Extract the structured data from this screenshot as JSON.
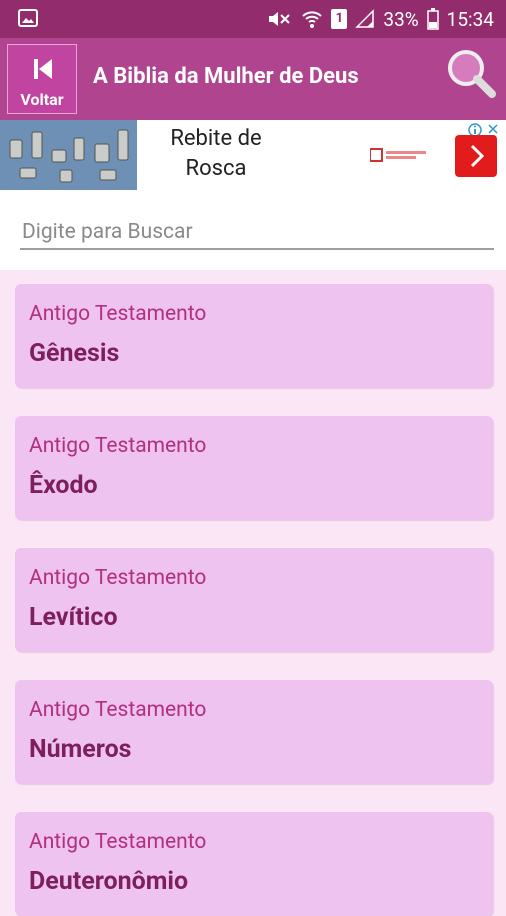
{
  "statusbar": {
    "battery": "33%",
    "time": "15:34",
    "sim": "1"
  },
  "appbar": {
    "back_label": "Voltar",
    "title": "A Biblia da Mulher de Deus"
  },
  "ad": {
    "text_line1": "Rebite de",
    "text_line2": "Rosca"
  },
  "search": {
    "placeholder": "Digite para Buscar"
  },
  "books": [
    {
      "testament": "Antigo Testamento",
      "name": "Gênesis"
    },
    {
      "testament": "Antigo Testamento",
      "name": "Êxodo"
    },
    {
      "testament": "Antigo Testamento",
      "name": "Levítico"
    },
    {
      "testament": "Antigo Testamento",
      "name": "Números"
    },
    {
      "testament": "Antigo Testamento",
      "name": "Deuteronômio"
    }
  ],
  "colors": {
    "statusbar": "#932c6c",
    "appbar": "#b0448f",
    "card": "#efc3ef",
    "card_title": "#7d1f5e",
    "card_sub": "#b1307f",
    "background": "#fbe6f6"
  }
}
